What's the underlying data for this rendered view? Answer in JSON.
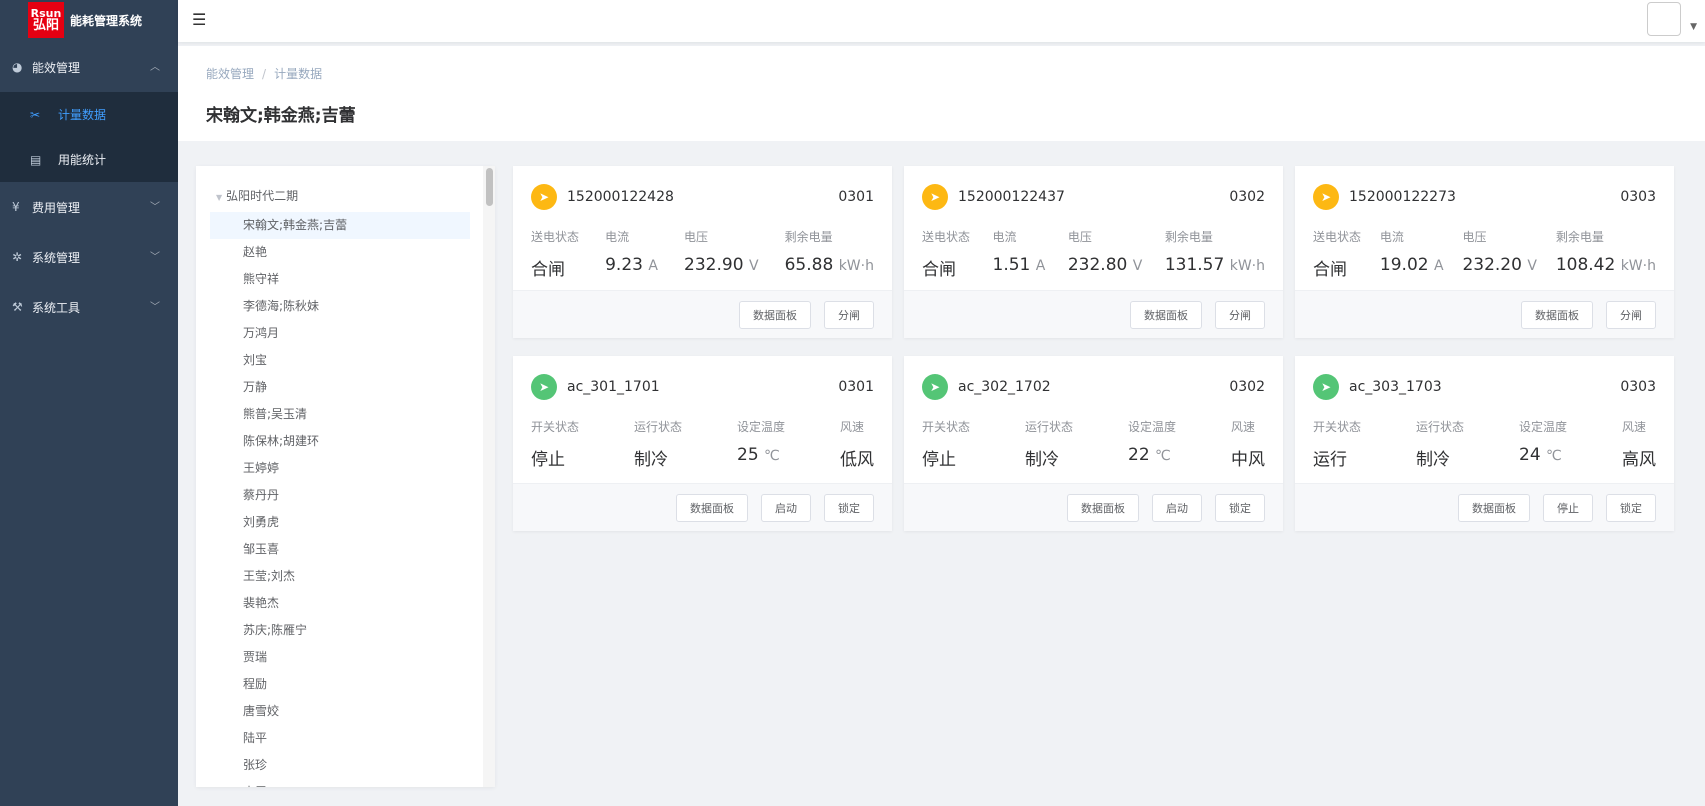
{
  "app": {
    "logo_line1": "Rsun",
    "logo_line2": "弘阳",
    "title": "能耗管理系统"
  },
  "sidebar": {
    "menus": [
      {
        "label": "能效管理",
        "icon": "dashboard-icon"
      },
      {
        "label": "费用管理",
        "icon": "yen-icon"
      },
      {
        "label": "系统管理",
        "icon": "gear-icon"
      },
      {
        "label": "系统工具",
        "icon": "tools-icon"
      }
    ],
    "submenu": [
      {
        "label": "计量数据",
        "icon": "scissors-icon",
        "active": true
      },
      {
        "label": "用能统计",
        "icon": "database-icon",
        "active": false
      }
    ]
  },
  "breadcrumb": {
    "items": [
      "能效管理",
      "计量数据"
    ],
    "separator": "/"
  },
  "page_title": "宋翰文;韩金燕;吉蕾",
  "tree": {
    "root": "弘阳时代二期",
    "nodes": [
      "宋翰文;韩金燕;吉蕾",
      "赵艳",
      "熊守祥",
      "李德海;陈秋妹",
      "万鸿月",
      "刘宝",
      "万静",
      "熊普;吴玉清",
      "陈保林;胡建环",
      "王婷婷",
      "蔡丹丹",
      "刘勇虎",
      "邹玉喜",
      "王莹;刘杰",
      "裴艳杰",
      "苏庆;陈雁宁",
      "贾瑞",
      "程励",
      "唐雪姣",
      "陆平",
      "张珍",
      "史雷"
    ]
  },
  "meters": [
    {
      "id": "152000122428",
      "room": "0301",
      "labels": [
        "送电状态",
        "电流",
        "电压",
        "剩余电量"
      ],
      "state": "合闸",
      "current": "9.23",
      "voltage": "232.90",
      "balance": "65.88",
      "units": [
        "A",
        "V",
        "kW·h"
      ],
      "buttons": [
        "数据面板",
        "分闸"
      ]
    },
    {
      "id": "152000122437",
      "room": "0302",
      "labels": [
        "送电状态",
        "电流",
        "电压",
        "剩余电量"
      ],
      "state": "合闸",
      "current": "1.51",
      "voltage": "232.80",
      "balance": "131.57",
      "units": [
        "A",
        "V",
        "kW·h"
      ],
      "buttons": [
        "数据面板",
        "分闸"
      ]
    },
    {
      "id": "152000122273",
      "room": "0303",
      "labels": [
        "送电状态",
        "电流",
        "电压",
        "剩余电量"
      ],
      "state": "合闸",
      "current": "19.02",
      "voltage": "232.20",
      "balance": "108.42",
      "units": [
        "A",
        "V",
        "kW·h"
      ],
      "buttons": [
        "数据面板",
        "分闸"
      ]
    }
  ],
  "acs": [
    {
      "id": "ac_301_1701",
      "room": "0301",
      "labels": [
        "开关状态",
        "运行状态",
        "设定温度",
        "风速"
      ],
      "power": "停止",
      "mode": "制冷",
      "temp": "25",
      "temp_unit": "℃",
      "fan": "低风",
      "buttons": [
        "数据面板",
        "启动",
        "锁定"
      ]
    },
    {
      "id": "ac_302_1702",
      "room": "0302",
      "labels": [
        "开关状态",
        "运行状态",
        "设定温度",
        "风速"
      ],
      "power": "停止",
      "mode": "制冷",
      "temp": "22",
      "temp_unit": "℃",
      "fan": "中风",
      "buttons": [
        "数据面板",
        "启动",
        "锁定"
      ]
    },
    {
      "id": "ac_303_1703",
      "room": "0303",
      "labels": [
        "开关状态",
        "运行状态",
        "设定温度",
        "风速"
      ],
      "power": "运行",
      "mode": "制冷",
      "temp": "24",
      "temp_unit": "℃",
      "fan": "高风",
      "buttons": [
        "数据面板",
        "停止",
        "锁定"
      ]
    }
  ],
  "colors": {
    "sidebar_bg": "#304156",
    "submenu_bg": "#1f2d3d",
    "accent": "#409eff",
    "meter_icon": "#fdb813",
    "ac_icon": "#54c576",
    "logo_red": "#e60012"
  }
}
